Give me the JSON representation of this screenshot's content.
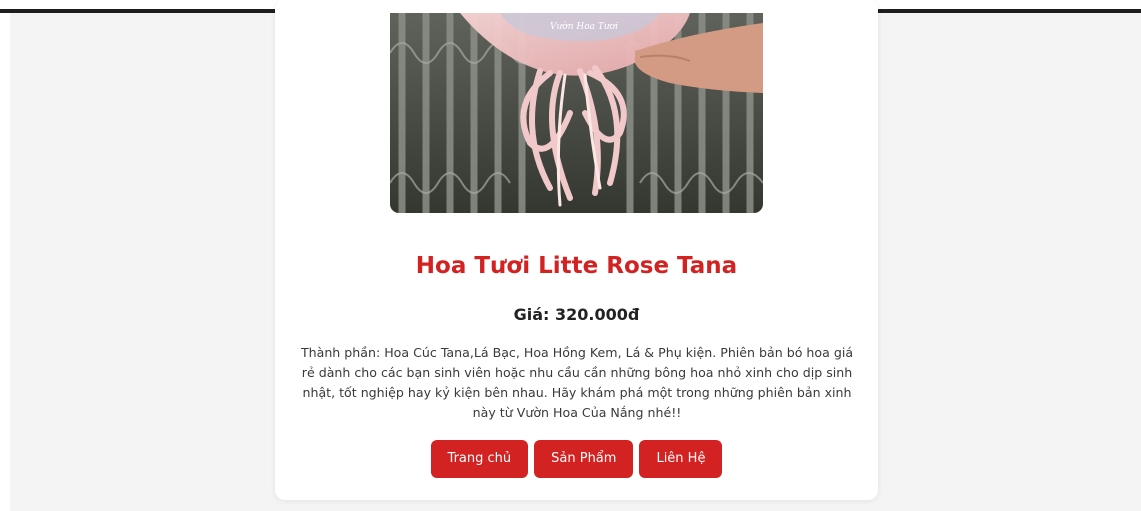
{
  "product": {
    "watermark": "Vườn Hoa Tươi",
    "title": "Hoa Tươi Litte Rose Tana",
    "price": "Giá: 320.000đ",
    "description": "Thành phần: Hoa Cúc Tana,Lá Bạc, Hoa Hồng Kem, Lá & Phụ kiện. Phiên bản bó hoa giá rẻ dành cho các bạn sinh viên hoặc nhu cầu cần những bông hoa nhỏ xinh cho dịp sinh nhật, tốt nghiệp hay kỷ kiện bên nhau. Hãy khám phá một trong những phiên bản xinh này từ Vườn Hoa Của Nắng nhé!!"
  },
  "nav": {
    "home": "Trang chủ",
    "products": "Sản Phẩm",
    "contact": "Liên Hệ"
  },
  "colors": {
    "accent": "#d32222",
    "background": "#f4f4f4",
    "card": "#ffffff"
  }
}
